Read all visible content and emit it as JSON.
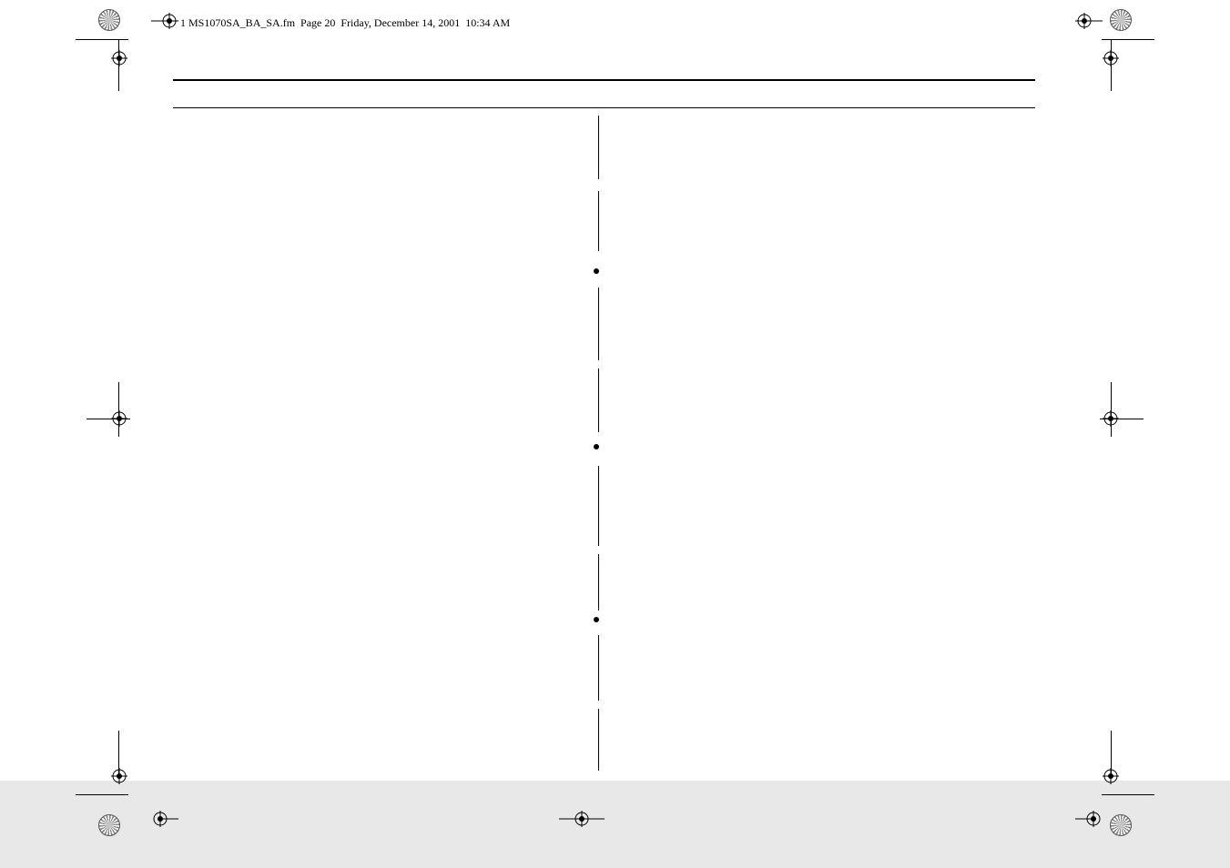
{
  "header": {
    "filename": "1 MS1070SA_BA_SA.fm",
    "page_label": "Page 20",
    "date": "Friday, December 14, 2001",
    "time": "10:34 AM"
  }
}
